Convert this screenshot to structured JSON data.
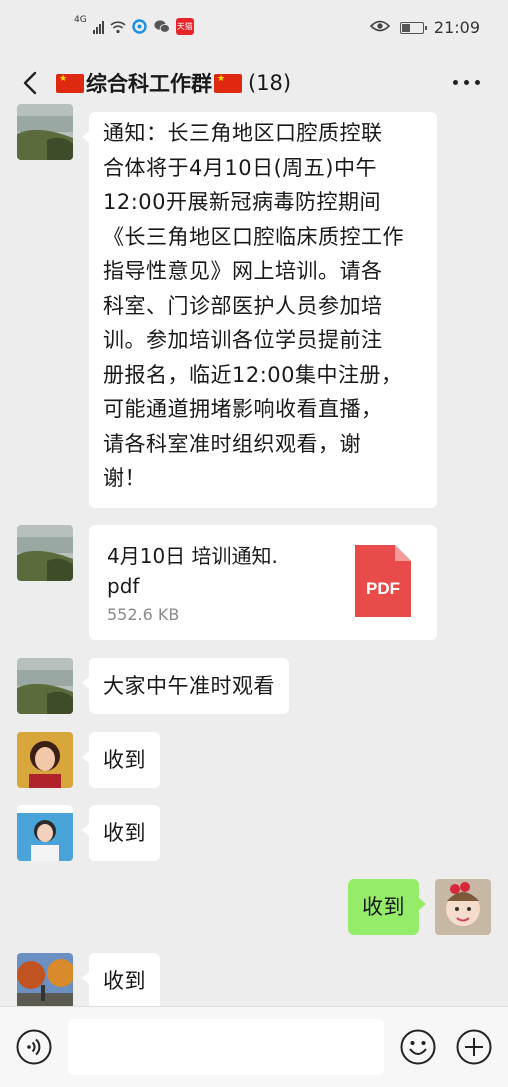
{
  "status_bar": {
    "network": "4G",
    "tmall_badge": "天猫",
    "time": "21:09"
  },
  "header": {
    "title": "综合科工作群",
    "member_count": "(18)"
  },
  "messages": [
    {
      "sender": "group-member-lake-avatar",
      "type": "text",
      "lines": [
        "通知：长三角地区口腔质控联",
        "合体将于4月10日(周五)中午",
        "12:00开展新冠病毒防控期间",
        "《长三角地区口腔临床质控工作",
        "指导性意见》网上培训。请各",
        "科室、门诊部医护人员参加培",
        "训。参加培训各位学员提前注",
        "册报名，临近12:00集中注册，",
        "可能通道拥堵影响收看直播，",
        "请各科室准时组织观看，谢",
        "谢！"
      ]
    },
    {
      "sender": "group-member-lake-avatar",
      "type": "file",
      "file_name_line1": "4月10日 培训通知.",
      "file_name_line2": "pdf",
      "file_size": "552.6 KB",
      "file_icon_label": "PDF"
    },
    {
      "sender": "group-member-lake-avatar",
      "type": "text",
      "text": "大家中午准时观看"
    },
    {
      "sender": "group-member-woman-avatar",
      "type": "text",
      "text": "收到"
    },
    {
      "sender": "group-member-girl-avatar",
      "type": "text",
      "text": "收到"
    },
    {
      "sender": "me",
      "type": "text",
      "text": "收到"
    },
    {
      "sender": "group-member-autumn-avatar",
      "type": "text",
      "text": "收到"
    }
  ],
  "colors": {
    "background": "#ededed",
    "my_bubble": "#95ec69",
    "pdf_red": "#e94a4a"
  }
}
